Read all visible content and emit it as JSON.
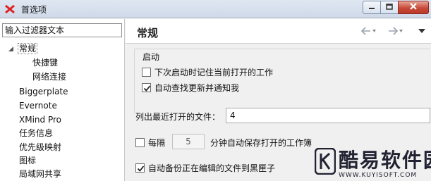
{
  "window": {
    "title": "首选项"
  },
  "filter": {
    "placeholder": "输入过滤器文本"
  },
  "tree": {
    "items": [
      {
        "label": "常规",
        "level": 0,
        "expanded": true,
        "selected": true
      },
      {
        "label": "快捷键",
        "level": 1
      },
      {
        "label": "网络连接",
        "level": 1
      },
      {
        "label": "Biggerplate",
        "level": 0
      },
      {
        "label": "Evernote",
        "level": 0
      },
      {
        "label": "XMind Pro",
        "level": 0
      },
      {
        "label": "任务信息",
        "level": 0
      },
      {
        "label": "优先级映射",
        "level": 0
      },
      {
        "label": "图标",
        "level": 0
      },
      {
        "label": "局域网共享",
        "level": 0
      }
    ]
  },
  "page": {
    "title": "常规"
  },
  "startup": {
    "group_title": "启动",
    "remember_label": "下次启动时记住当前打开的工作",
    "remember_checked": false,
    "auto_update_label": "自动查找更新并通知我",
    "auto_update_checked": true
  },
  "recent": {
    "label": "列出最近打开的文件：",
    "value": "4"
  },
  "autosave": {
    "label_before": "每隔",
    "interval_value": "5",
    "label_after": "分钟自动保存打开的工作簿",
    "checked": false
  },
  "backup": {
    "label": "自动备份正在编辑的文件到黑匣子",
    "checked": true
  },
  "watermark": {
    "big_text": "酷易软件园",
    "small_text": "WWW.KUYISOFT.COM"
  },
  "icons": {
    "app": "xmind-icon",
    "minimize": "minimize-icon",
    "maximize": "maximize-icon",
    "close": "close-icon",
    "back": "arrow-left-icon",
    "forward": "arrow-right-icon",
    "menu": "chevron-down-icon",
    "tree_toggle": "tree-expanded-icon"
  },
  "colors": {
    "close_button": "#c74a38",
    "titlebar": "#dfe7f2",
    "selection_border": "#777777"
  }
}
